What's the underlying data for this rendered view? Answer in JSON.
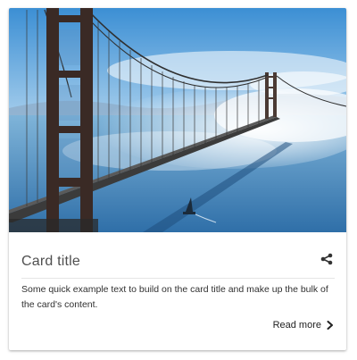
{
  "card": {
    "title": "Card title",
    "text": "Some quick example text to build on the card title and make up the bulk of the card's content.",
    "read_more_label": "Read more"
  },
  "icons": {
    "share": "share-icon",
    "chevron": "chevron-right-icon"
  },
  "colors": {
    "title_text": "#4f4f4f",
    "body_text": "#303030",
    "divider": "#e6e6e6"
  }
}
